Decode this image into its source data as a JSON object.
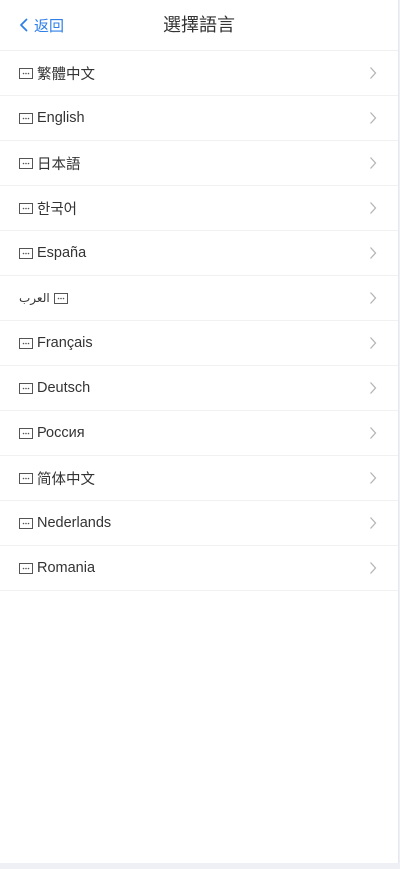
{
  "header": {
    "back_label": "返回",
    "title": "選擇語言"
  },
  "languages": [
    {
      "label": "繁體中文"
    },
    {
      "label": "English"
    },
    {
      "label": "日本語"
    },
    {
      "label": "한국어"
    },
    {
      "label": "España"
    },
    {
      "label": "العرب"
    },
    {
      "label": "Français"
    },
    {
      "label": "Deutsch"
    },
    {
      "label": "Россия"
    },
    {
      "label": "简体中文"
    },
    {
      "label": "Nederlands"
    },
    {
      "label": "Romania"
    }
  ],
  "colors": {
    "accent": "#2f7fe8",
    "text": "#333333",
    "chevron": "#b5b5b5",
    "background": "#eef0f5"
  },
  "icons": {
    "back": "chevron-left-icon",
    "flag": "flag-placeholder-icon",
    "row_arrow": "chevron-right-icon"
  }
}
